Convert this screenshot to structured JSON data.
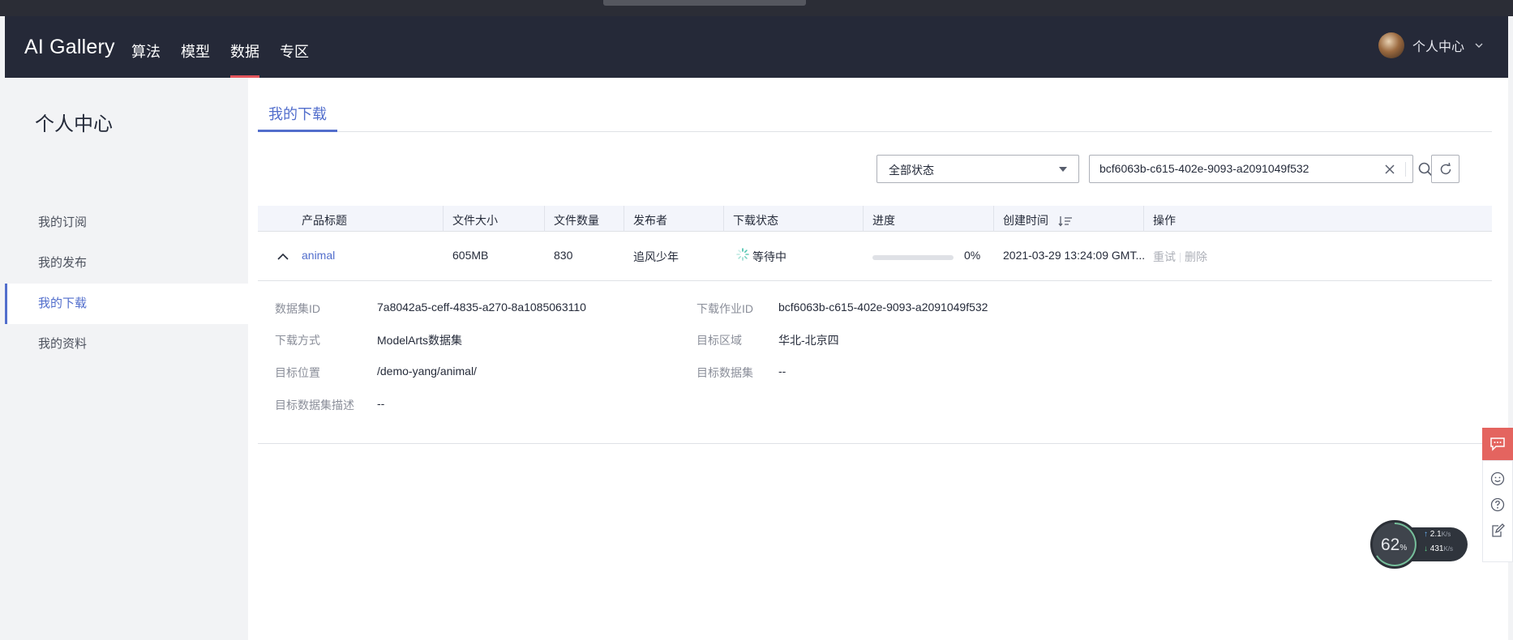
{
  "colors": {
    "accent": "#526ecc",
    "nav_bg": "#252938",
    "active_underline": "#e4555c",
    "float_accent": "#e4645f"
  },
  "header": {
    "brand": "AI Gallery",
    "nav": [
      {
        "label": "算法"
      },
      {
        "label": "模型"
      },
      {
        "label": "数据",
        "active": true
      },
      {
        "label": "专区"
      }
    ],
    "user": {
      "label": "个人中心"
    }
  },
  "sidebar": {
    "title": "个人中心",
    "items": [
      {
        "label": "我的订阅"
      },
      {
        "label": "我的发布"
      },
      {
        "label": "我的下载",
        "active": true
      },
      {
        "label": "我的资料"
      }
    ]
  },
  "tabs": [
    {
      "label": "我的下载",
      "active": true
    }
  ],
  "filters": {
    "status_select": "全部状态",
    "search_value": "bcf6063b-c615-402e-9093-a2091049f532"
  },
  "table": {
    "columns": [
      "产品标题",
      "文件大小",
      "文件数量",
      "发布者",
      "下载状态",
      "进度",
      "创建时间",
      "操作"
    ],
    "rows": [
      {
        "title": "animal",
        "size": "605MB",
        "count": "830",
        "publisher": "追风少年",
        "status": "等待中",
        "progress_label": "0%",
        "progress_value": 0,
        "created": "2021-03-29 13:24:09 GMT...",
        "actions": [
          "重试",
          "删除"
        ]
      }
    ]
  },
  "detail": {
    "left": [
      {
        "label": "数据集ID",
        "value": "7a8042a5-ceff-4835-a270-8a1085063110"
      },
      {
        "label": "下载方式",
        "value": "ModelArts数据集"
      },
      {
        "label": "目标位置",
        "value": "/demo-yang/animal/"
      },
      {
        "label": "目标数据集描述",
        "value": "--"
      }
    ],
    "right": [
      {
        "label": "下载作业ID",
        "value": "bcf6063b-c615-402e-9093-a2091049f532"
      },
      {
        "label": "目标区域",
        "value": "华北-北京四"
      },
      {
        "label": "目标数据集",
        "value": "--"
      }
    ]
  },
  "net_monitor": {
    "percent": "62",
    "percent_unit": "%",
    "up": "2.1",
    "down": "431",
    "unit": "K/s"
  }
}
